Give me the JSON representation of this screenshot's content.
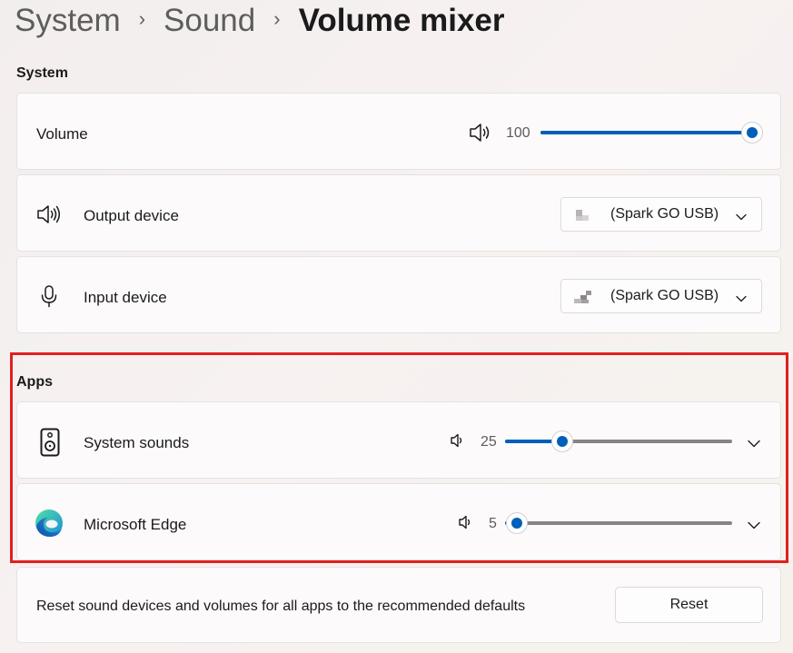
{
  "breadcrumb": [
    "System",
    "Sound",
    "Volume mixer"
  ],
  "system_section": {
    "title": "System",
    "volume": {
      "label": "Volume",
      "value": "100",
      "level": 1.0
    },
    "output": {
      "label": "Output device",
      "selected": "(Spark GO USB)"
    },
    "input": {
      "label": "Input device",
      "selected": "(Spark GO USB)"
    }
  },
  "apps_section": {
    "title": "Apps",
    "apps": [
      {
        "label": "System sounds",
        "value": "25",
        "level": 0.25,
        "icon": "speaker-box-icon"
      },
      {
        "label": "Microsoft Edge",
        "value": "5",
        "level": 0.05,
        "icon": "edge-logo-icon"
      }
    ]
  },
  "reset": {
    "description": "Reset sound devices and volumes for all apps to the recommended defaults",
    "button": "Reset"
  },
  "colors": {
    "accent": "#005fb8",
    "highlight": "#e02020"
  }
}
